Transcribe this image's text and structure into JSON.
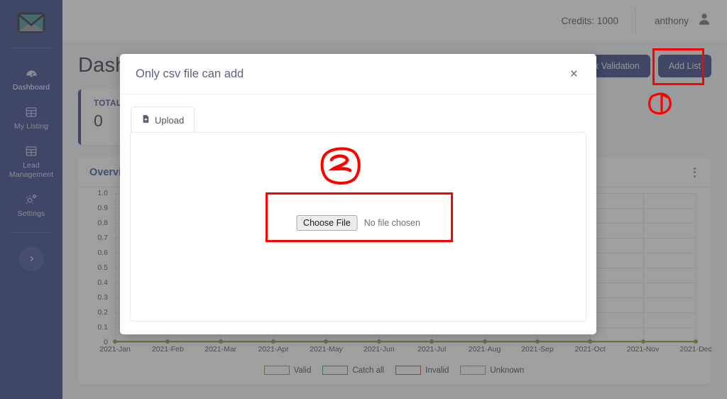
{
  "brand": {
    "logo_icon": "envelope-icon",
    "sidebar_color": "#2c3b80",
    "accent": "#2c3b80"
  },
  "sidebar": {
    "collapse_icon": "chevron-right-icon",
    "items": [
      {
        "label": "Dashboard",
        "icon": "gauge-icon",
        "active": true
      },
      {
        "label": "My Listing",
        "icon": "table-grid-icon",
        "active": false
      },
      {
        "label": "Lead Management",
        "icon": "table-grid-icon",
        "active": false
      },
      {
        "label": "Settings",
        "icon": "gears-icon",
        "active": false
      }
    ]
  },
  "topbar": {
    "credits": "Credits: 1000",
    "user_name": "anthony",
    "avatar_icon": "user-avatar-icon"
  },
  "page": {
    "title": "Dashboard",
    "buttons": [
      {
        "label": "Quick Validation",
        "name": "quick-validation-button"
      },
      {
        "label": "Add List",
        "name": "add-list-button"
      }
    ]
  },
  "stat_card": {
    "label": "TOTAL VE",
    "value": "0"
  },
  "chart_card": {
    "title": "Overview",
    "menu_icon": "kebab-menu-icon"
  },
  "chart_data": {
    "type": "line",
    "title": "Overview",
    "xlabel": "",
    "ylabel": "",
    "ylim": [
      0,
      1.0
    ],
    "grid": true,
    "legend_position": "bottom",
    "yticks": [
      "1.0",
      "0.9",
      "0.8",
      "0.7",
      "0.6",
      "0.5",
      "0.4",
      "0.3",
      "0.2",
      "0.1",
      "0"
    ],
    "categories": [
      "2021-Jan",
      "2021-Feb",
      "2021-Mar",
      "2021-Apr",
      "2021-May",
      "2021-Jun",
      "2021-Jul",
      "2021-Aug",
      "2021-Sep",
      "2021-Oct",
      "2021-Nov",
      "2021-Dec"
    ],
    "series": [
      {
        "name": "Valid",
        "color": "#8a9a2b",
        "values": [
          0,
          0,
          0,
          0,
          0,
          0,
          0,
          0,
          0,
          0,
          0,
          0
        ]
      },
      {
        "name": "Catch all",
        "color": "#4e8a94",
        "values": [
          0,
          0,
          0,
          0,
          0,
          0,
          0,
          0,
          0,
          0,
          0,
          0
        ]
      },
      {
        "name": "Invalid",
        "color": "#c2403f",
        "values": [
          0,
          0,
          0,
          0,
          0,
          0,
          0,
          0,
          0,
          0,
          0,
          0
        ]
      },
      {
        "name": "Unknown",
        "color": "#9a9a9a",
        "values": [
          0,
          0,
          0,
          0,
          0,
          0,
          0,
          0,
          0,
          0,
          0,
          0
        ]
      }
    ]
  },
  "modal": {
    "title": "Only csv file can add",
    "close_label": "×",
    "tab": {
      "label": "Upload",
      "icon": "file-upload-icon"
    },
    "file_input": {
      "button_label": "Choose File",
      "status": "No file chosen"
    }
  },
  "annotations": {
    "color": "#fe0000",
    "markers": [
      {
        "label": "1",
        "target": "add-list-button"
      },
      {
        "label": "2",
        "target": "choose-file-input"
      }
    ]
  }
}
